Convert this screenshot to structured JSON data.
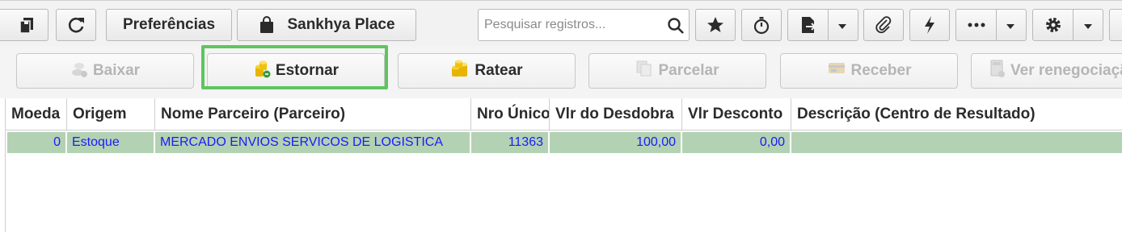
{
  "toolbar": {
    "preferences_label": "Preferências",
    "sankhya_place_label": "Sankhya Place",
    "search_placeholder": "Pesquisar registros...",
    "icons": [
      "copy-icon",
      "refresh-icon",
      "shopping-bag-icon",
      "search-icon",
      "star-icon",
      "stopwatch-icon",
      "export-document-icon",
      "chevron-down-icon",
      "paperclip-icon",
      "lightning-icon",
      "more-icon",
      "gear-icon"
    ]
  },
  "actions": {
    "baixar": "Baixar",
    "estornar": "Estornar",
    "ratear": "Ratear",
    "parcelar": "Parcelar",
    "receber": "Receber",
    "ver_renegociacao": "Ver renegociação"
  },
  "grid": {
    "columns": [
      "Moeda",
      "Origem",
      "Nome Parceiro (Parceiro)",
      "Nro Único",
      "Vlr do Desdobra",
      "Vlr Desconto",
      "Descrição (Centro de Resultado)"
    ],
    "rows": [
      {
        "moeda": "0",
        "origem": "Estoque",
        "nome_parceiro": "MERCADO ENVIOS SERVICOS DE LOGISTICA",
        "nro_unico": "11363",
        "vlr_desdobra": "100,00",
        "vlr_desconto": "0,00",
        "descricao": ""
      }
    ]
  },
  "colors": {
    "highlight_border": "#5ec55e",
    "row_selected_bg": "#b3d2b3",
    "row_text": "#1a1aff"
  }
}
